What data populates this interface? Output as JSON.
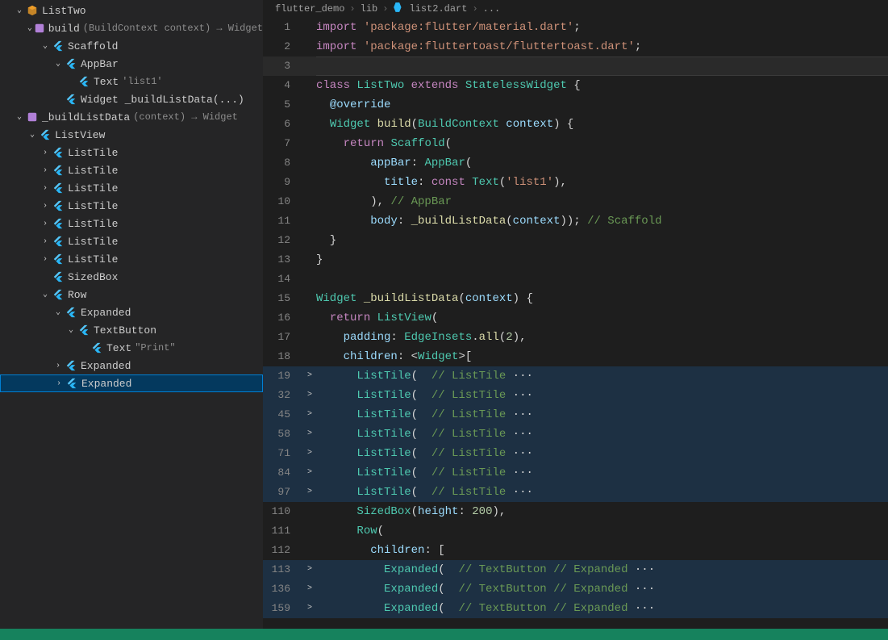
{
  "breadcrumbs": [
    "flutter_demo",
    "lib",
    "list2.dart",
    "..."
  ],
  "outline": [
    {
      "ind": 16,
      "chev": "down",
      "icon": "class",
      "label": "ListTwo"
    },
    {
      "ind": 32,
      "chev": "down",
      "icon": "method",
      "label": "build",
      "dim": "(BuildContext context) → Widget"
    },
    {
      "ind": 48,
      "chev": "down",
      "icon": "flutter",
      "label": "Scaffold"
    },
    {
      "ind": 64,
      "chev": "down",
      "icon": "flutter",
      "label": "AppBar"
    },
    {
      "ind": 80,
      "chev": "",
      "icon": "flutter",
      "label": "Text",
      "dim": "'list1'"
    },
    {
      "ind": 64,
      "chev": "",
      "icon": "flutter",
      "label": "Widget _buildListData(...)"
    },
    {
      "ind": 16,
      "chev": "down",
      "icon": "method",
      "label": "_buildListData",
      "dim": "(context) → Widget"
    },
    {
      "ind": 32,
      "chev": "down",
      "icon": "flutter",
      "label": "ListView"
    },
    {
      "ind": 48,
      "chev": "right",
      "icon": "flutter",
      "label": "ListTile"
    },
    {
      "ind": 48,
      "chev": "right",
      "icon": "flutter",
      "label": "ListTile"
    },
    {
      "ind": 48,
      "chev": "right",
      "icon": "flutter",
      "label": "ListTile"
    },
    {
      "ind": 48,
      "chev": "right",
      "icon": "flutter",
      "label": "ListTile"
    },
    {
      "ind": 48,
      "chev": "right",
      "icon": "flutter",
      "label": "ListTile"
    },
    {
      "ind": 48,
      "chev": "right",
      "icon": "flutter",
      "label": "ListTile"
    },
    {
      "ind": 48,
      "chev": "right",
      "icon": "flutter",
      "label": "ListTile"
    },
    {
      "ind": 48,
      "chev": "",
      "icon": "flutter",
      "label": "SizedBox"
    },
    {
      "ind": 48,
      "chev": "down",
      "icon": "flutter",
      "label": "Row"
    },
    {
      "ind": 64,
      "chev": "down",
      "icon": "flutter",
      "label": "Expanded"
    },
    {
      "ind": 80,
      "chev": "down",
      "icon": "flutter",
      "label": "TextButton"
    },
    {
      "ind": 96,
      "chev": "",
      "icon": "flutter",
      "label": "Text",
      "dim": "\"Print\""
    },
    {
      "ind": 64,
      "chev": "right",
      "icon": "flutter",
      "label": "Expanded"
    },
    {
      "ind": 64,
      "chev": "right",
      "icon": "flutter",
      "label": "Expanded",
      "sel": true
    }
  ],
  "code": [
    {
      "n": "1",
      "t": [
        [
          "kw",
          "import"
        ],
        [
          "pl",
          " "
        ],
        [
          "str",
          "'package:flutter/material.dart'"
        ],
        [
          "pl",
          ";"
        ]
      ]
    },
    {
      "n": "2",
      "t": [
        [
          "kw",
          "import"
        ],
        [
          "pl",
          " "
        ],
        [
          "str",
          "'package:fluttertoast/fluttertoast.dart'"
        ],
        [
          "pl",
          ";"
        ]
      ]
    },
    {
      "n": "3",
      "cursor": true,
      "t": [
        [
          "pl",
          ""
        ]
      ]
    },
    {
      "n": "4",
      "t": [
        [
          "kw",
          "class"
        ],
        [
          "pl",
          " "
        ],
        [
          "ty",
          "ListTwo"
        ],
        [
          "pl",
          " "
        ],
        [
          "kw",
          "extends"
        ],
        [
          "pl",
          " "
        ],
        [
          "ty",
          "StatelessWidget"
        ],
        [
          "pl",
          " {"
        ]
      ]
    },
    {
      "n": "5",
      "t": [
        [
          "pl",
          "  "
        ],
        [
          "pr",
          "@override"
        ]
      ]
    },
    {
      "n": "6",
      "t": [
        [
          "pl",
          "  "
        ],
        [
          "ty",
          "Widget"
        ],
        [
          "pl",
          " "
        ],
        [
          "fn",
          "build"
        ],
        [
          "pl",
          "("
        ],
        [
          "ty",
          "BuildContext"
        ],
        [
          "pl",
          " "
        ],
        [
          "pr",
          "context"
        ],
        [
          "pl",
          ") {"
        ]
      ]
    },
    {
      "n": "7",
      "t": [
        [
          "pl",
          "    "
        ],
        [
          "kw",
          "return"
        ],
        [
          "pl",
          " "
        ],
        [
          "ty",
          "Scaffold"
        ],
        [
          "pl",
          "("
        ]
      ]
    },
    {
      "n": "8",
      "t": [
        [
          "pl",
          "        "
        ],
        [
          "pr",
          "appBar"
        ],
        [
          "pl",
          ": "
        ],
        [
          "ty",
          "AppBar"
        ],
        [
          "pl",
          "("
        ]
      ]
    },
    {
      "n": "9",
      "t": [
        [
          "pl",
          "          "
        ],
        [
          "pr",
          "title"
        ],
        [
          "pl",
          ": "
        ],
        [
          "kw",
          "const"
        ],
        [
          "pl",
          " "
        ],
        [
          "ty",
          "Text"
        ],
        [
          "pl",
          "("
        ],
        [
          "str",
          "'list1'"
        ],
        [
          "pl",
          "),"
        ]
      ]
    },
    {
      "n": "10",
      "t": [
        [
          "pl",
          "        ), "
        ],
        [
          "cm",
          "// AppBar"
        ]
      ]
    },
    {
      "n": "11",
      "t": [
        [
          "pl",
          "        "
        ],
        [
          "pr",
          "body"
        ],
        [
          "pl",
          ": "
        ],
        [
          "fn",
          "_buildListData"
        ],
        [
          "pl",
          "("
        ],
        [
          "pr",
          "context"
        ],
        [
          "pl",
          ")); "
        ],
        [
          "cm",
          "// Scaffold"
        ]
      ]
    },
    {
      "n": "12",
      "t": [
        [
          "pl",
          "  }"
        ]
      ]
    },
    {
      "n": "13",
      "t": [
        [
          "pl",
          "}"
        ]
      ]
    },
    {
      "n": "14",
      "t": [
        [
          "pl",
          ""
        ]
      ]
    },
    {
      "n": "15",
      "t": [
        [
          "ty",
          "Widget"
        ],
        [
          "pl",
          " "
        ],
        [
          "fn",
          "_buildListData"
        ],
        [
          "pl",
          "("
        ],
        [
          "pr",
          "context"
        ],
        [
          "pl",
          ") {"
        ]
      ]
    },
    {
      "n": "16",
      "t": [
        [
          "pl",
          "  "
        ],
        [
          "kw",
          "return"
        ],
        [
          "pl",
          " "
        ],
        [
          "ty",
          "ListView"
        ],
        [
          "pl",
          "("
        ]
      ]
    },
    {
      "n": "17",
      "t": [
        [
          "pl",
          "    "
        ],
        [
          "pr",
          "padding"
        ],
        [
          "pl",
          ": "
        ],
        [
          "ty",
          "EdgeInsets"
        ],
        [
          "pl",
          "."
        ],
        [
          "fn",
          "all"
        ],
        [
          "pl",
          "("
        ],
        [
          "num",
          "2"
        ],
        [
          "pl",
          "),"
        ]
      ]
    },
    {
      "n": "18",
      "t": [
        [
          "pl",
          "    "
        ],
        [
          "pr",
          "children"
        ],
        [
          "pl",
          ": <"
        ],
        [
          "ty",
          "Widget"
        ],
        [
          "pl",
          ">["
        ]
      ]
    },
    {
      "n": "19",
      "f": ">",
      "hl": true,
      "t": [
        [
          "pl",
          "      "
        ],
        [
          "ty",
          "ListTile"
        ],
        [
          "pl",
          "( "
        ],
        [
          "cm",
          " // ListTile "
        ],
        [
          "op",
          "···"
        ]
      ]
    },
    {
      "n": "32",
      "f": ">",
      "hl": true,
      "t": [
        [
          "pl",
          "      "
        ],
        [
          "ty",
          "ListTile"
        ],
        [
          "pl",
          "( "
        ],
        [
          "cm",
          " // ListTile "
        ],
        [
          "op",
          "···"
        ]
      ]
    },
    {
      "n": "45",
      "f": ">",
      "hl": true,
      "t": [
        [
          "pl",
          "      "
        ],
        [
          "ty",
          "ListTile"
        ],
        [
          "pl",
          "( "
        ],
        [
          "cm",
          " // ListTile "
        ],
        [
          "op",
          "···"
        ]
      ]
    },
    {
      "n": "58",
      "f": ">",
      "hl": true,
      "t": [
        [
          "pl",
          "      "
        ],
        [
          "ty",
          "ListTile"
        ],
        [
          "pl",
          "( "
        ],
        [
          "cm",
          " // ListTile "
        ],
        [
          "op",
          "···"
        ]
      ]
    },
    {
      "n": "71",
      "f": ">",
      "hl": true,
      "t": [
        [
          "pl",
          "      "
        ],
        [
          "ty",
          "ListTile"
        ],
        [
          "pl",
          "( "
        ],
        [
          "cm",
          " // ListTile "
        ],
        [
          "op",
          "···"
        ]
      ]
    },
    {
      "n": "84",
      "f": ">",
      "hl": true,
      "t": [
        [
          "pl",
          "      "
        ],
        [
          "ty",
          "ListTile"
        ],
        [
          "pl",
          "( "
        ],
        [
          "cm",
          " // ListTile "
        ],
        [
          "op",
          "···"
        ]
      ]
    },
    {
      "n": "97",
      "f": ">",
      "hl": true,
      "t": [
        [
          "pl",
          "      "
        ],
        [
          "ty",
          "ListTile"
        ],
        [
          "pl",
          "( "
        ],
        [
          "cm",
          " // ListTile "
        ],
        [
          "op",
          "···"
        ]
      ]
    },
    {
      "n": "110",
      "t": [
        [
          "pl",
          "      "
        ],
        [
          "ty",
          "SizedBox"
        ],
        [
          "pl",
          "("
        ],
        [
          "pr",
          "height"
        ],
        [
          "pl",
          ": "
        ],
        [
          "num",
          "200"
        ],
        [
          "pl",
          "),"
        ]
      ]
    },
    {
      "n": "111",
      "t": [
        [
          "pl",
          "      "
        ],
        [
          "ty",
          "Row"
        ],
        [
          "pl",
          "("
        ]
      ]
    },
    {
      "n": "112",
      "t": [
        [
          "pl",
          "        "
        ],
        [
          "pr",
          "children"
        ],
        [
          "pl",
          ": ["
        ]
      ]
    },
    {
      "n": "113",
      "f": ">",
      "hl": true,
      "t": [
        [
          "pl",
          "          "
        ],
        [
          "ty",
          "Expanded"
        ],
        [
          "pl",
          "( "
        ],
        [
          "cm",
          " // TextButton // Expanded "
        ],
        [
          "op",
          "···"
        ]
      ]
    },
    {
      "n": "136",
      "f": ">",
      "hl": true,
      "t": [
        [
          "pl",
          "          "
        ],
        [
          "ty",
          "Expanded"
        ],
        [
          "pl",
          "( "
        ],
        [
          "cm",
          " // TextButton // Expanded "
        ],
        [
          "op",
          "···"
        ]
      ]
    },
    {
      "n": "159",
      "f": ">",
      "hl": true,
      "t": [
        [
          "pl",
          "          "
        ],
        [
          "ty",
          "Expanded"
        ],
        [
          "pl",
          "( "
        ],
        [
          "cm",
          " // TextButton // Expanded "
        ],
        [
          "op",
          "···"
        ]
      ]
    }
  ]
}
